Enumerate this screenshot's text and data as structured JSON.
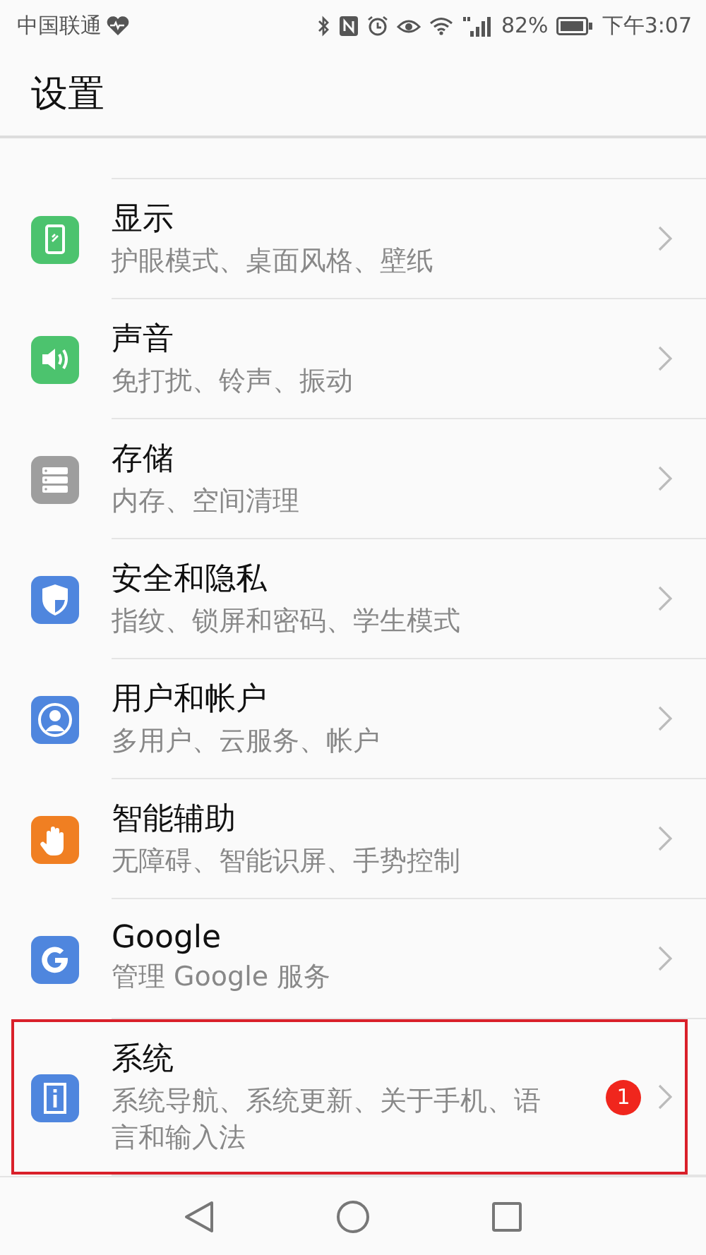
{
  "status_bar": {
    "carrier": "中国联通",
    "battery_percent": "82%",
    "time": "下午3:07"
  },
  "header": {
    "title": "设置"
  },
  "items": [
    {
      "kind": "display",
      "color": "#4cc36e",
      "title": "显示",
      "subtitle": "护眼模式、桌面风格、壁纸",
      "annotated": false
    },
    {
      "kind": "sound",
      "color": "#4cc36e",
      "title": "声音",
      "subtitle": "免打扰、铃声、振动",
      "annotated": false
    },
    {
      "kind": "storage",
      "color": "#9e9e9e",
      "title": "存储",
      "subtitle": "内存、空间清理",
      "annotated": false
    },
    {
      "kind": "security",
      "color": "#4f86de",
      "title": "安全和隐私",
      "subtitle": "指纹、锁屏和密码、学生模式",
      "annotated": false
    },
    {
      "kind": "account",
      "color": "#4f86de",
      "title": "用户和帐户",
      "subtitle": "多用户、云服务、帐户",
      "annotated": false
    },
    {
      "kind": "assist",
      "color": "#f07f22",
      "title": "智能辅助",
      "subtitle": "无障碍、智能识屏、手势控制",
      "annotated": false
    },
    {
      "kind": "google",
      "color": "#4f86de",
      "title": "Google",
      "subtitle": "管理 Google 服务",
      "annotated": false
    },
    {
      "kind": "system",
      "color": "#4f86de",
      "title": "系统",
      "subtitle": "系统导航、系统更新、关于手机、语言和输入法",
      "badge": "1",
      "annotated": true
    }
  ]
}
